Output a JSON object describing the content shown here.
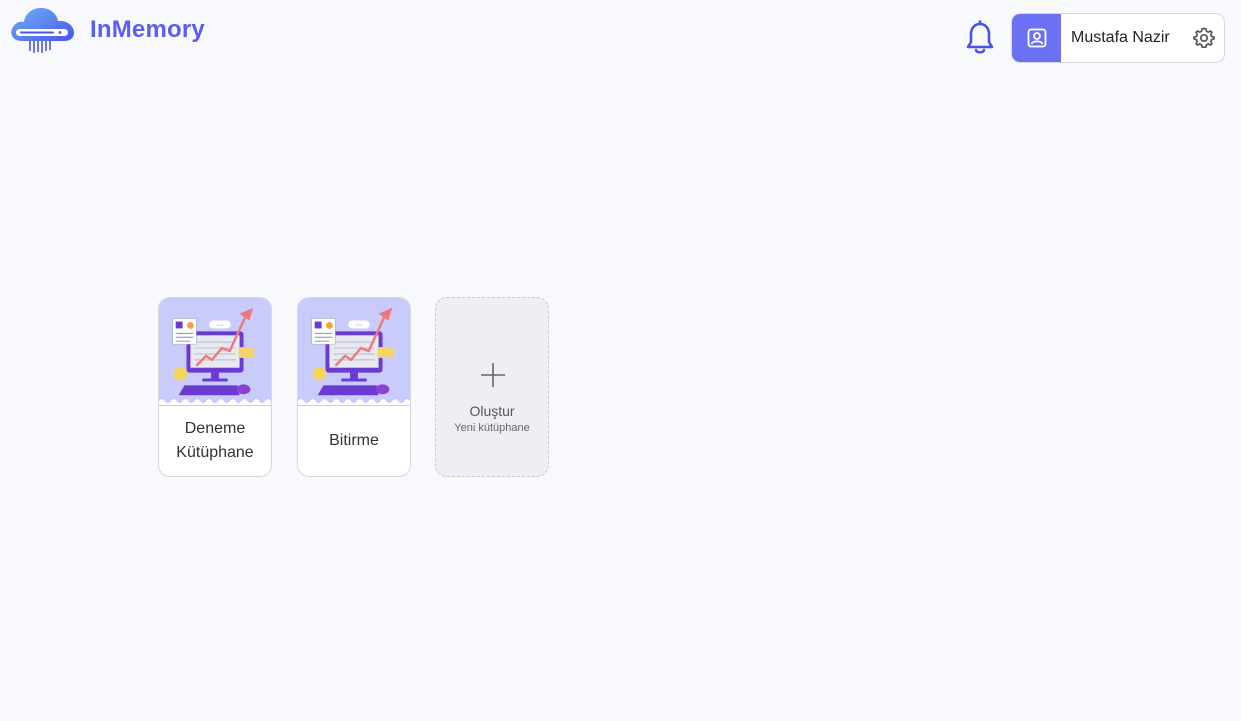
{
  "app": {
    "brand": "InMemory",
    "logo_icon": "cloud-chip-icon"
  },
  "header": {
    "notification_icon": "bell-icon"
  },
  "user": {
    "name": "Mustafa Nazir",
    "avatar_icon": "user-card-icon",
    "settings_icon": "gear-icon"
  },
  "libraries": [
    {
      "name": "Deneme Kütüphane",
      "image": "computer-growth-illustration"
    },
    {
      "name": "Bitirme",
      "image": "computer-growth-illustration"
    }
  ],
  "create_card": {
    "title": "Oluştur",
    "subtitle": "Yeni kütüphane",
    "icon": "plus-icon"
  },
  "colors": {
    "accent": "#5a5ff0",
    "avatar_bg": "#6c70f4",
    "card_thumb_bg": "#c9cbfa",
    "page_bg": "#f8f9fd"
  }
}
